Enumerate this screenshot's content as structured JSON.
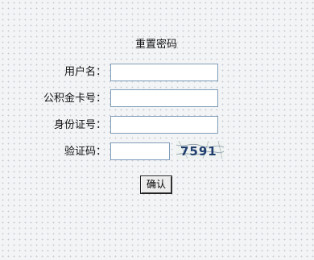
{
  "form": {
    "title": "重置密码",
    "fields": [
      {
        "label": "用户名：",
        "value": "",
        "placeholder": ""
      },
      {
        "label": "公积金卡号：",
        "value": "",
        "placeholder": ""
      },
      {
        "label": "身份证号：",
        "value": "",
        "placeholder": ""
      },
      {
        "label": "验证码：",
        "value": "",
        "placeholder": ""
      }
    ],
    "captcha": {
      "text": "7591",
      "text_color": "#1f3e6e",
      "noise_color": "#8a9aa6",
      "background": "#eef2f0"
    },
    "submit_label": "确认"
  }
}
